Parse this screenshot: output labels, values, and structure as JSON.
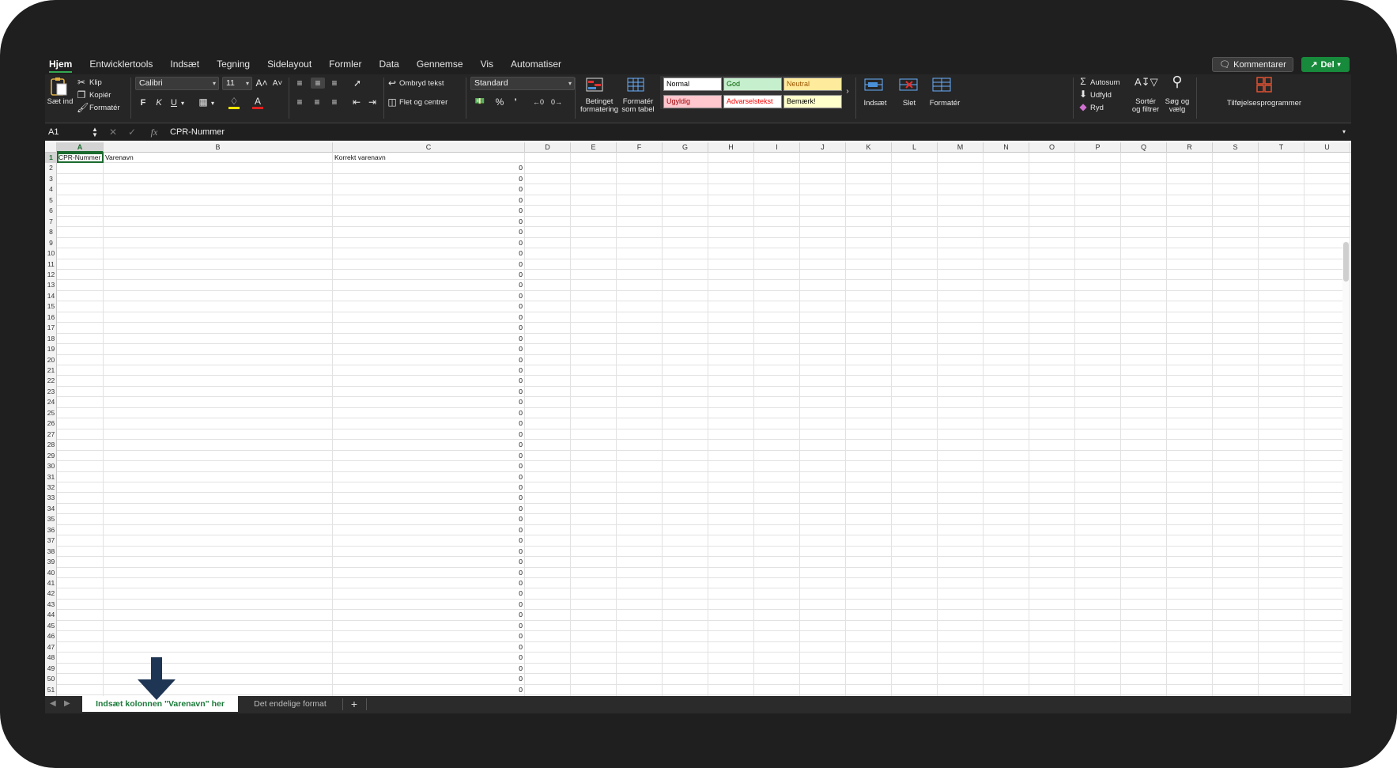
{
  "ribbon_tabs": [
    "Hjem",
    "Entwicklertools",
    "Indsæt",
    "Tegning",
    "Sidelayout",
    "Formler",
    "Data",
    "Gennemse",
    "Vis",
    "Automatiser"
  ],
  "active_tab": "Hjem",
  "header_buttons": {
    "comments": "Kommentarer",
    "share": "Del"
  },
  "clipboard": {
    "paste": "Sæt ind",
    "cut": "Klip",
    "copy": "Kopiér",
    "format_painter": "Formatér"
  },
  "font": {
    "name": "Calibri",
    "size": "11",
    "bold": "F",
    "italic": "K",
    "underline": "U"
  },
  "alignment": {
    "wrap": "Ombryd tekst",
    "merge": "Flet og centrer"
  },
  "number": {
    "format": "Standard"
  },
  "styles_group": {
    "conditional": [
      "Betinget",
      "formatering"
    ],
    "as_table": [
      "Formatér",
      "som tabel"
    ],
    "cells": [
      {
        "label": "Normal",
        "bg": "#ffffff",
        "fg": "#000000"
      },
      {
        "label": "God",
        "bg": "#c6efce",
        "fg": "#006100"
      },
      {
        "label": "Neutral",
        "bg": "#ffeb9c",
        "fg": "#9c5700"
      },
      {
        "label": "Ugyldig",
        "bg": "#ffc7ce",
        "fg": "#9c0006"
      },
      {
        "label": "Advarselstekst",
        "bg": "#ffffff",
        "fg": "#ff0000"
      },
      {
        "label": "Bemærk!",
        "bg": "#ffffcc",
        "fg": "#000000"
      }
    ]
  },
  "cells_group": {
    "insert": "Indsæt",
    "delete": "Slet",
    "format": "Formatér"
  },
  "editing": {
    "autosum": "Autosum",
    "fill": "Udfyld",
    "clear": "Ryd",
    "sort": [
      "Sortér",
      "og filtrer"
    ],
    "find": [
      "Søg og",
      "vælg"
    ]
  },
  "addins": "Tilføjelsesprogrammer",
  "formula_bar": {
    "name_box": "A1",
    "fx": "fx",
    "value": "CPR-Nummer"
  },
  "columns": [
    "A",
    "B",
    "C",
    "D",
    "E",
    "F",
    "G",
    "H",
    "I",
    "J",
    "K",
    "L",
    "M",
    "N",
    "O",
    "P",
    "Q",
    "R",
    "S",
    "T",
    "U"
  ],
  "selected_column": "A",
  "headers_row": {
    "A": "CPR-Nummer",
    "B": "Varenavn",
    "C": "Korrekt varenavn"
  },
  "row_count": 51,
  "column_c_value": "0",
  "sheet_tabs": [
    {
      "label": "Indsæt kolonnen \"Varenavn\" her",
      "active": true
    },
    {
      "label": "Det endelige format",
      "active": false
    }
  ],
  "add_sheet": "+",
  "colors": {
    "accent_green": "#1b7a3a",
    "arrow": "#1f3554",
    "dark_bg": "#1f1f1f"
  }
}
